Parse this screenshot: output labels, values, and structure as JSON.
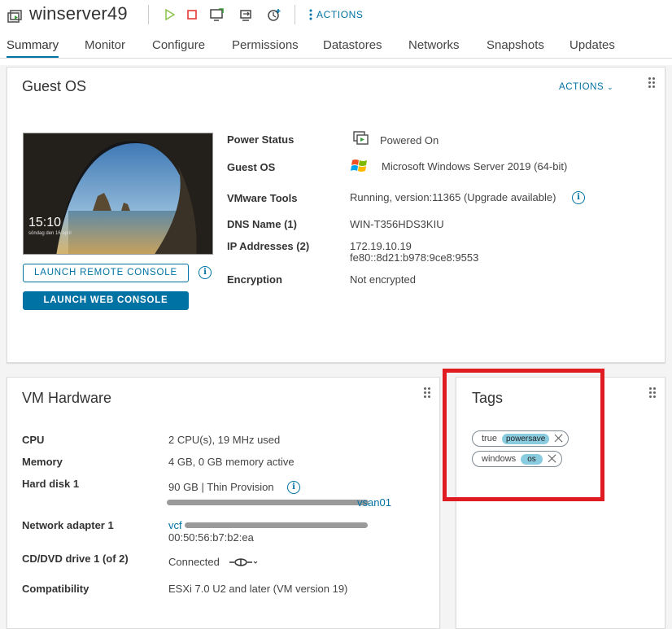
{
  "header": {
    "vm_name": "winserver49",
    "actions_label": "ACTIONS",
    "toolbar_icons": [
      "power-on-icon",
      "power-off-icon",
      "launch-console-icon",
      "migrate-icon",
      "snapshot-icon"
    ]
  },
  "tabs": [
    "Summary",
    "Monitor",
    "Configure",
    "Permissions",
    "Datastores",
    "Networks",
    "Snapshots",
    "Updates"
  ],
  "active_tab": "Summary",
  "guest_os": {
    "title": "Guest OS",
    "actions_label": "ACTIONS",
    "thumbnail": {
      "time": "15:10",
      "date": "söndag den 16 april"
    },
    "launch_remote_label": "LAUNCH REMOTE CONSOLE",
    "launch_web_label": "LAUNCH WEB CONSOLE",
    "fields": {
      "power_status_label": "Power Status",
      "power_status_value": "Powered On",
      "guest_os_label": "Guest OS",
      "guest_os_value": "Microsoft Windows Server 2019 (64-bit)",
      "vmware_tools_label": "VMware Tools",
      "vmware_tools_value": "Running, version:11365 (Upgrade available)",
      "dns_label": "DNS Name (1)",
      "dns_value": "WIN-T356HDS3KIU",
      "ip_label": "IP Addresses (2)",
      "ip_value_1": "172.19.10.19",
      "ip_value_2": "fe80::8d21:b978:9ce8:9553",
      "encryption_label": "Encryption",
      "encryption_value": "Not encrypted"
    }
  },
  "vm_hardware": {
    "title": "VM Hardware",
    "cpu_label": "CPU",
    "cpu_value": "2 CPU(s), 19 MHz used",
    "memory_label": "Memory",
    "memory_value": "4 GB, 0 GB memory active",
    "disk_label": "Hard disk 1",
    "disk_value": "90 GB | Thin Provision",
    "disk_datastore_suffix": "vsan01",
    "net_label": "Network adapter 1",
    "net_value_prefix": "vcf",
    "net_mac": "00:50:56:b7:b2:ea",
    "cd_label": "CD/DVD drive 1 (of 2)",
    "cd_value": "Connected",
    "compat_label": "Compatibility",
    "compat_value": "ESXi 7.0 U2 and later (VM version 19)"
  },
  "tags": {
    "title": "Tags",
    "items": [
      {
        "value": "true",
        "category": "powersave"
      },
      {
        "value": "windows",
        "category": "os"
      }
    ]
  },
  "colors": {
    "accent": "#0072a3",
    "highlight_box": "#e11b22",
    "tag_category_bg": "#89cbdf"
  }
}
